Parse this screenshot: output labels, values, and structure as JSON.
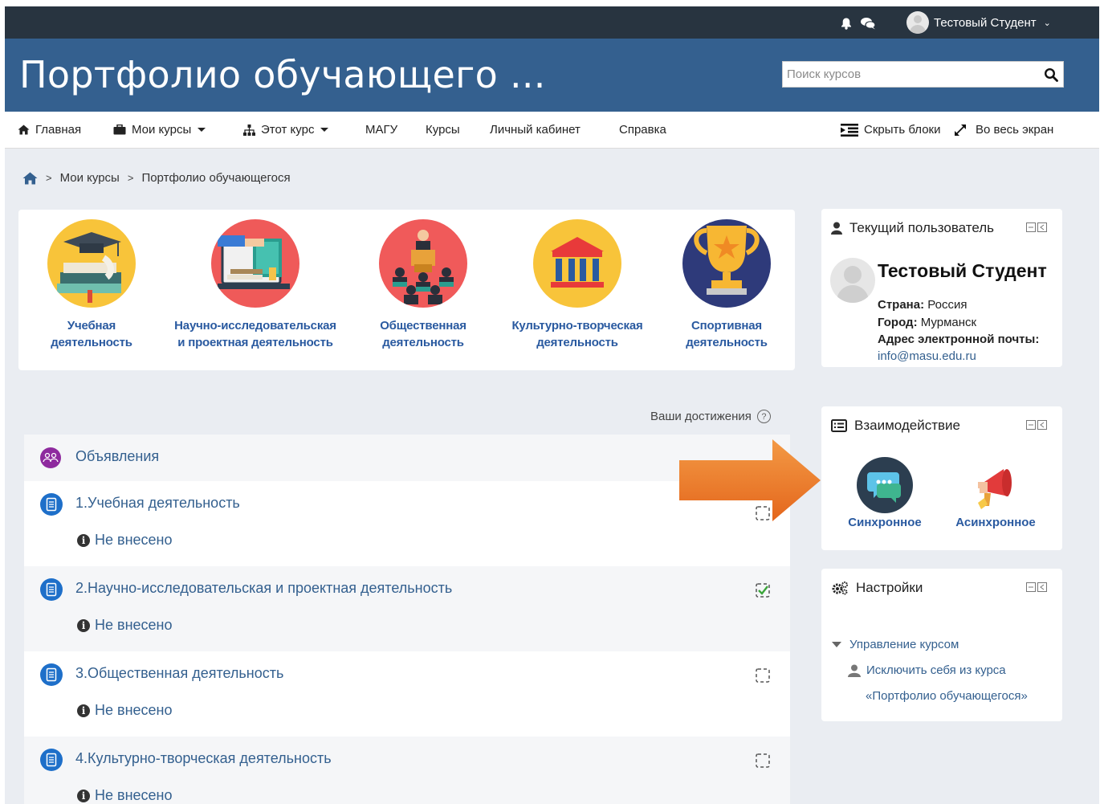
{
  "topbar": {
    "user_name": "Тестовый Студент",
    "icons": [
      "bell-icon",
      "chat-icon",
      "avatar",
      "chevron-down-icon"
    ]
  },
  "header": {
    "title": "Портфолио обучающего ...",
    "search_placeholder": "Поиск курсов"
  },
  "nav": {
    "home": "Главная",
    "my_courses": "Мои курсы",
    "this_course": "Этот курс",
    "masu": "МАГУ",
    "courses": "Курсы",
    "cabinet": "Личный кабинет",
    "help": "Справка",
    "hide_blocks": "Скрыть блоки",
    "fullscreen": "Во весь экран"
  },
  "breadcrumb": {
    "items": [
      "Мои курсы",
      "Портфолио обучающегося"
    ]
  },
  "categories": [
    {
      "line1": "Учебная",
      "line2": "деятельность",
      "icon": "graduation-icon"
    },
    {
      "line1": "Научно-исследовательская",
      "line2": "и проектная деятельность",
      "icon": "laptop-research-icon"
    },
    {
      "line1": "Общественная",
      "line2": "деятельность",
      "icon": "audience-icon"
    },
    {
      "line1": "Культурно-творческая",
      "line2": "деятельность",
      "icon": "museum-icon"
    },
    {
      "line1": "Спортивная",
      "line2": "деятельность",
      "icon": "trophy-icon"
    }
  ],
  "achievements_label": "Ваши достижения",
  "sections": [
    {
      "title": "Объявления"
    },
    {
      "title": "1.Учебная деятельность",
      "status": "Не внесено",
      "checked": false
    },
    {
      "title": "2.Научно-исследовательская и проектная деятельность",
      "status": "Не внесено",
      "checked": true
    },
    {
      "title": "3.Общественная деятельность",
      "status": "Не внесено",
      "checked": false
    },
    {
      "title": "4.Культурно-творческая деятельность",
      "status": "Не внесено",
      "checked": false
    }
  ],
  "current_user": {
    "heading": "Текущий пользователь",
    "name": "Тестовый Студент",
    "country_label": "Страна:",
    "country": "Россия",
    "city_label": "Город:",
    "city": "Мурманск",
    "email_label": "Адрес электронной почты:",
    "email": "info@masu.edu.ru"
  },
  "interaction": {
    "heading": "Взаимодействие",
    "sync": "Синхронное",
    "async": "Асинхронное"
  },
  "settings": {
    "heading": "Настройки",
    "manage": "Управление курсом",
    "unenrol_line1": "Исключить себя из курса",
    "unenrol_line2": "«Портфолио обучающегося»"
  },
  "colors": {
    "header_bg": "#34608f",
    "topbar_bg": "#283440",
    "link": "#34608f",
    "page_bg": "#eaedf2",
    "arrow": "#ee7a2a"
  }
}
